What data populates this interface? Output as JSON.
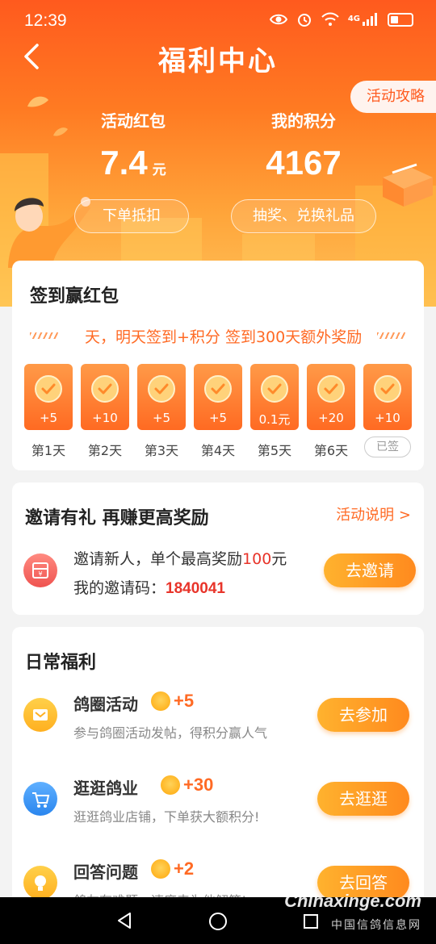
{
  "status_bar": {
    "time": "12:39",
    "signal_label": "4G"
  },
  "header": {
    "title": "福利中心",
    "guide_label": "活动攻略"
  },
  "stats": {
    "red_packet": {
      "label": "活动红包",
      "value": "7.4",
      "unit": "元",
      "button": "下单抵扣"
    },
    "points": {
      "label": "我的积分",
      "value": "4167",
      "button": "抽奖、兑换礼品"
    }
  },
  "checkin": {
    "title": "签到赢红包",
    "ticker": "天，明天签到+积分 签到300天额外奖励",
    "days": [
      {
        "points": "+5",
        "label": "第1天"
      },
      {
        "points": "+10",
        "label": "第2天"
      },
      {
        "points": "+5",
        "label": "第3天"
      },
      {
        "points": "+5",
        "label": "第4天"
      },
      {
        "points": "0.1元",
        "label": "第5天"
      },
      {
        "points": "+20",
        "label": "第6天"
      },
      {
        "points": "+10",
        "label": "已签"
      }
    ]
  },
  "invite": {
    "title": "邀请有礼  再赚更高奖励",
    "rules_link": "活动说明 >",
    "line1": "邀请新人，单个最高奖励",
    "line1_amount": "100",
    "line1_unit": "元",
    "code_label": "我的邀请码：",
    "code_value": "1840041",
    "button": "去邀请"
  },
  "daily": {
    "title": "日常福利",
    "tasks": [
      {
        "name": "鸽圈活动",
        "points": "+5",
        "desc": "参与鸽圈活动发帖，得积分赢人气",
        "button": "去参加"
      },
      {
        "name": "逛逛鸽业",
        "points": "+30",
        "desc": "逛逛鸽业店铺，下单获大额积分!",
        "button": "去逛逛"
      },
      {
        "name": "回答问题",
        "points": "+2",
        "desc": "鸽友有难题，速度来为他解答!",
        "button": "去回答"
      }
    ]
  },
  "watermark": {
    "main": "Chinaxinge.com",
    "sub": "中国信鸽信息网"
  },
  "colors": {
    "accent": "#ff6a24",
    "header_top": "#ff5a1e",
    "red_highlight": "#e8342a"
  }
}
